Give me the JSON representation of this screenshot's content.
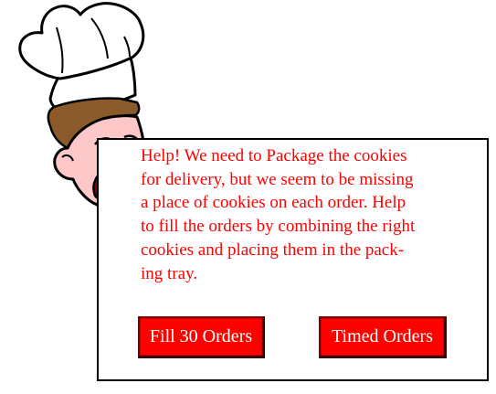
{
  "dialog": {
    "message": "Help!  We need to Package the cookies\nfor delivery, but we seem to be missing\na place of cookies on each order.  Help\nto fill the orders by combining the right\ncookies and placing them in the pack-\ning tray."
  },
  "buttons": {
    "fill_orders": "Fill 30 Orders",
    "timed_orders": "Timed Orders"
  },
  "colors": {
    "text": "#ff0000",
    "button_bg": "#ff0000",
    "button_text": "#ffffff",
    "skin": "#ffc8c8",
    "hair": "#8b5a2b"
  },
  "icons": {
    "character": "chef-character"
  }
}
